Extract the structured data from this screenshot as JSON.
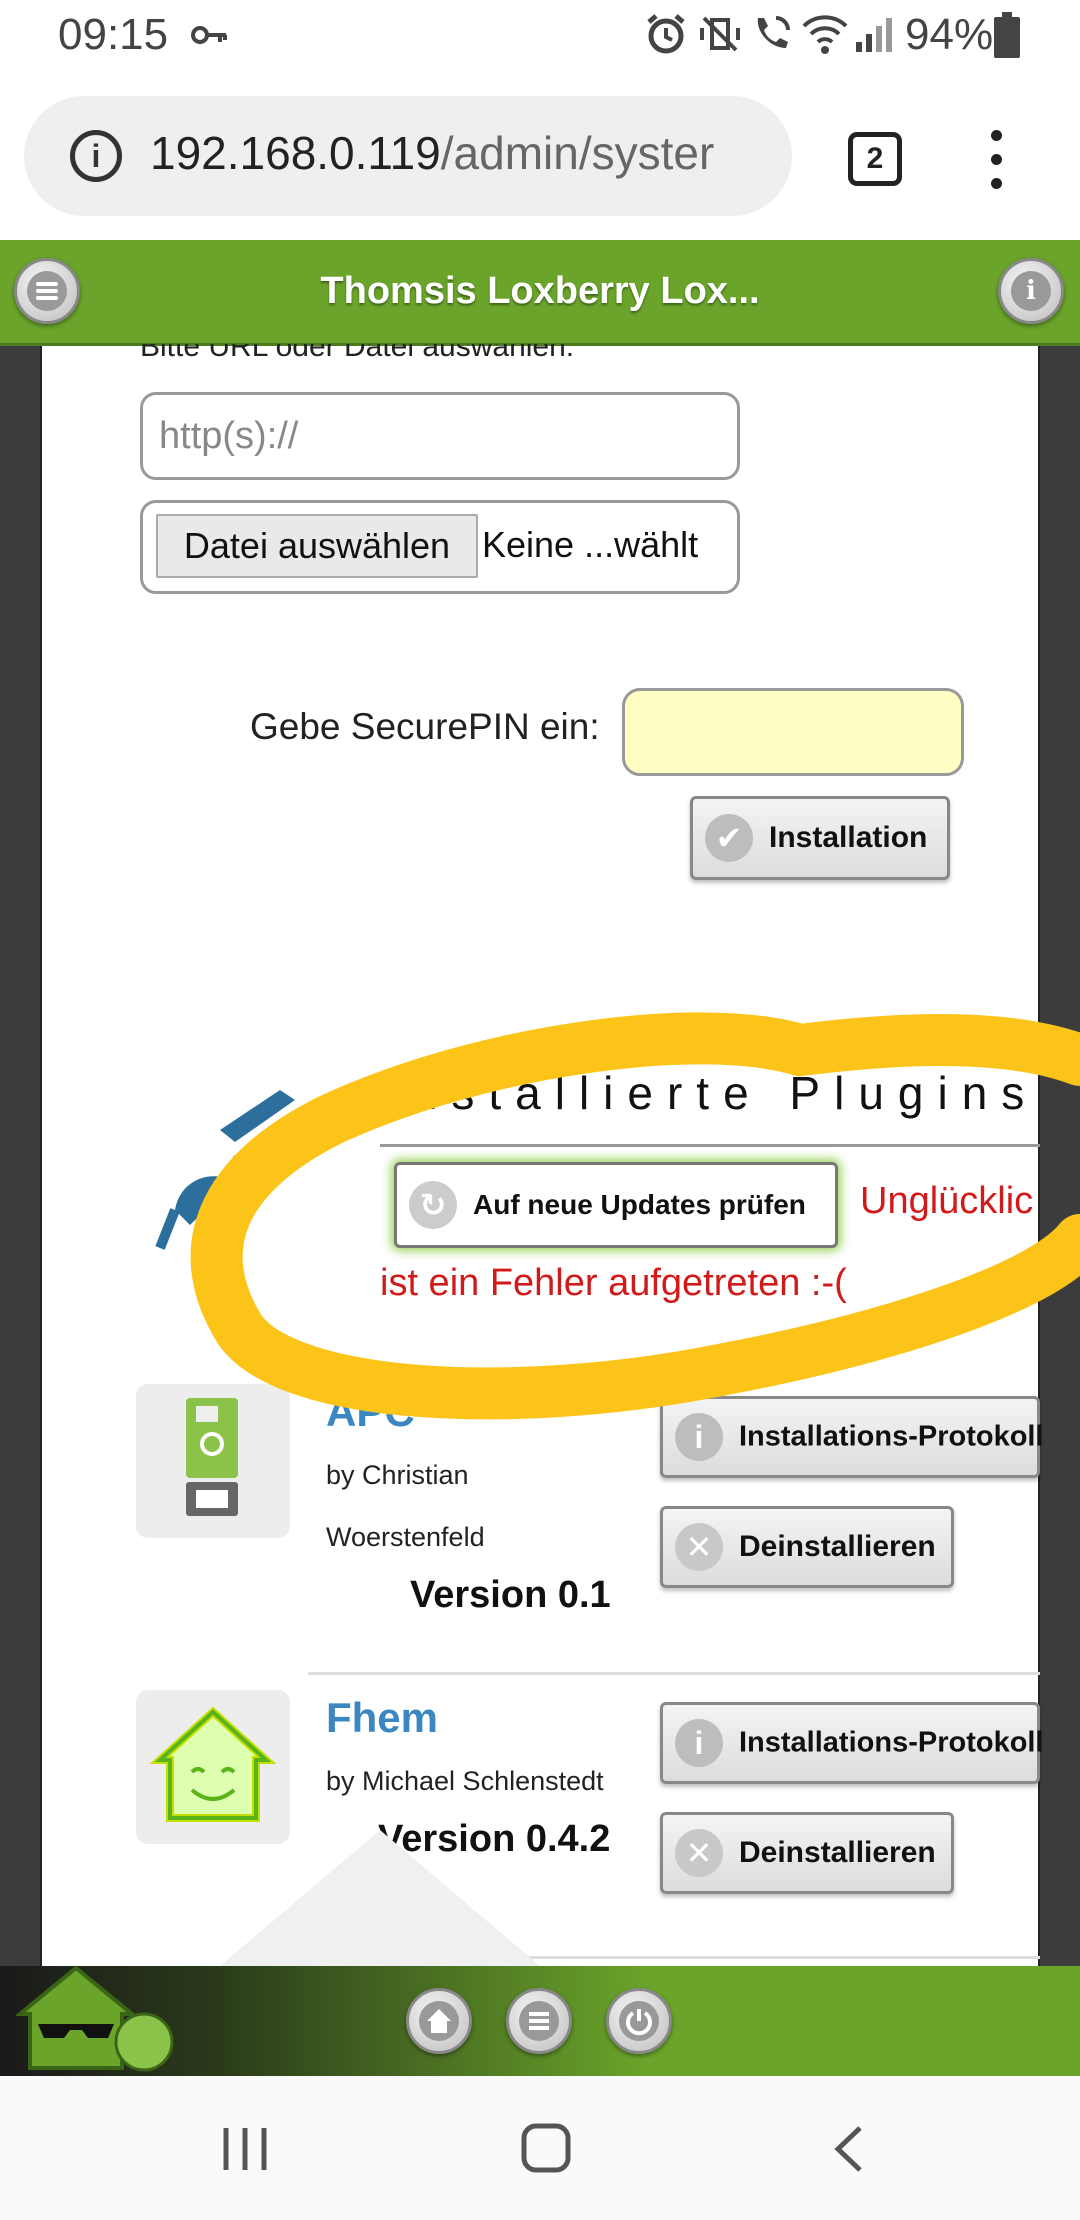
{
  "status_bar": {
    "time": "09:15",
    "battery": "94%"
  },
  "browser": {
    "url_host": "192.168.0.119",
    "url_path": "/admin/syster",
    "tab_count": "2"
  },
  "app_header": {
    "title": "Thomsis Loxberry Lox..."
  },
  "install_form": {
    "cut_label": "Bitte URL oder Datei auswählen:",
    "url_placeholder": "http(s)://",
    "file_button": "Datei auswählen",
    "file_status": "Keine ...wählt",
    "pin_label": "Gebe SecurePIN ein:",
    "install_button": "Installation"
  },
  "plugins": {
    "title": "Installierte Plugins",
    "update_button": "Auf neue Updates prüfen",
    "error_line1": "Unglücklic",
    "error_line2": "ist ein Fehler aufgetreten :-(",
    "items": [
      {
        "name": "APC",
        "author_line1": "by Christian",
        "author_line2": "Woerstenfeld",
        "version": "Version 0.1",
        "protocol_button": "Installations-Protokoll",
        "uninstall_button": "Deinstallieren"
      },
      {
        "name": "Fhem",
        "author_line1": "by Michael Schlenstedt",
        "author_line2": "",
        "version": "Version 0.4.2",
        "protocol_button": "Installations-Protokoll",
        "uninstall_button": "Deinstallieren"
      }
    ]
  },
  "colors": {
    "header_green": "#6aa42a",
    "error_red": "#d11a1a",
    "plugin_link_blue": "#3a87c2",
    "highlight_yellow": "#fcc419",
    "pin_bg": "#ffffc4"
  }
}
